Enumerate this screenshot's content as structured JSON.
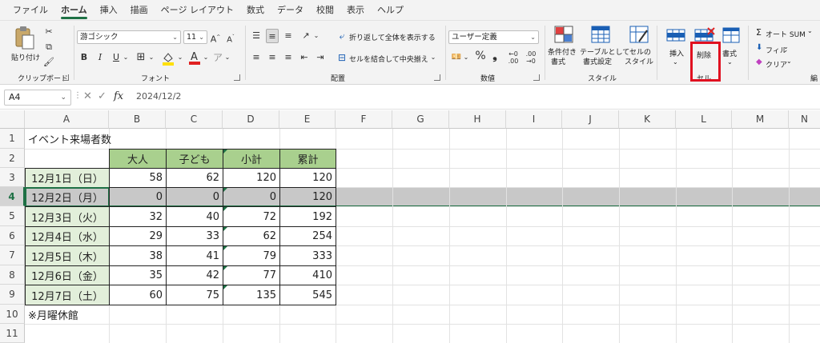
{
  "menu": {
    "tabs": [
      "ファイル",
      "ホーム",
      "挿入",
      "描画",
      "ページ レイアウト",
      "数式",
      "データ",
      "校閲",
      "表示",
      "ヘルプ"
    ],
    "active": "ホーム"
  },
  "ribbon": {
    "clipboard": {
      "paste": "貼り付け",
      "label": "クリップボード"
    },
    "font": {
      "name": "游ゴシック",
      "size": "11",
      "bold": "B",
      "italic": "I",
      "underline": "U",
      "label": "フォント",
      "font_color": "#e02020",
      "fill_color": "#ffe000"
    },
    "alignment": {
      "wrap": "折り返して全体を表示する",
      "merge": "セルを結合して中央揃え",
      "label": "配置"
    },
    "number": {
      "format": "ユーザー定義",
      "percent": "%",
      "comma": "❟",
      "label": "数値"
    },
    "styles": {
      "conditional": [
        "条件付き",
        "書式"
      ],
      "table": [
        "テーブルとして",
        "書式設定"
      ],
      "cell": [
        "セルの",
        "スタイル"
      ],
      "label": "スタイル"
    },
    "cells": {
      "insert": "挿入",
      "delete": "削除",
      "format": "書式",
      "label": "セル"
    },
    "editing": {
      "autosum": "オート SUM",
      "fill": "フィル",
      "clear": "クリア",
      "label_cut": "編"
    }
  },
  "formula_bar": {
    "name_box": "A4",
    "fx": "fx",
    "value": "2024/12/2"
  },
  "grid": {
    "columns": [
      "A",
      "B",
      "C",
      "D",
      "E",
      "F",
      "G",
      "H",
      "I",
      "J",
      "K",
      "L",
      "M",
      "N"
    ],
    "rows": [
      "1",
      "2",
      "3",
      "4",
      "5",
      "6",
      "7",
      "8",
      "9",
      "10",
      "11"
    ],
    "selected_row": "4",
    "title": "イベント来場者数",
    "headers": [
      "大人",
      "子ども",
      "小計",
      "累計"
    ],
    "data": [
      {
        "date": "12月1日（日）",
        "adult": "58",
        "child": "62",
        "subtotal": "120",
        "total": "120"
      },
      {
        "date": "12月2日（月）",
        "adult": "0",
        "child": "0",
        "subtotal": "0",
        "total": "120"
      },
      {
        "date": "12月3日（火）",
        "adult": "32",
        "child": "40",
        "subtotal": "72",
        "total": "192"
      },
      {
        "date": "12月4日（水）",
        "adult": "29",
        "child": "33",
        "subtotal": "62",
        "total": "254"
      },
      {
        "date": "12月5日（木）",
        "adult": "38",
        "child": "41",
        "subtotal": "79",
        "total": "333"
      },
      {
        "date": "12月6日（金）",
        "adult": "35",
        "child": "42",
        "subtotal": "77",
        "total": "410"
      },
      {
        "date": "12月7日（土）",
        "adult": "60",
        "child": "75",
        "subtotal": "135",
        "total": "545"
      }
    ],
    "note": "※月曜休館"
  },
  "colors": {
    "accent": "#1e7145",
    "header_fill": "#a9d08e",
    "date_fill": "#e2efda",
    "highlight": "#e01020"
  }
}
